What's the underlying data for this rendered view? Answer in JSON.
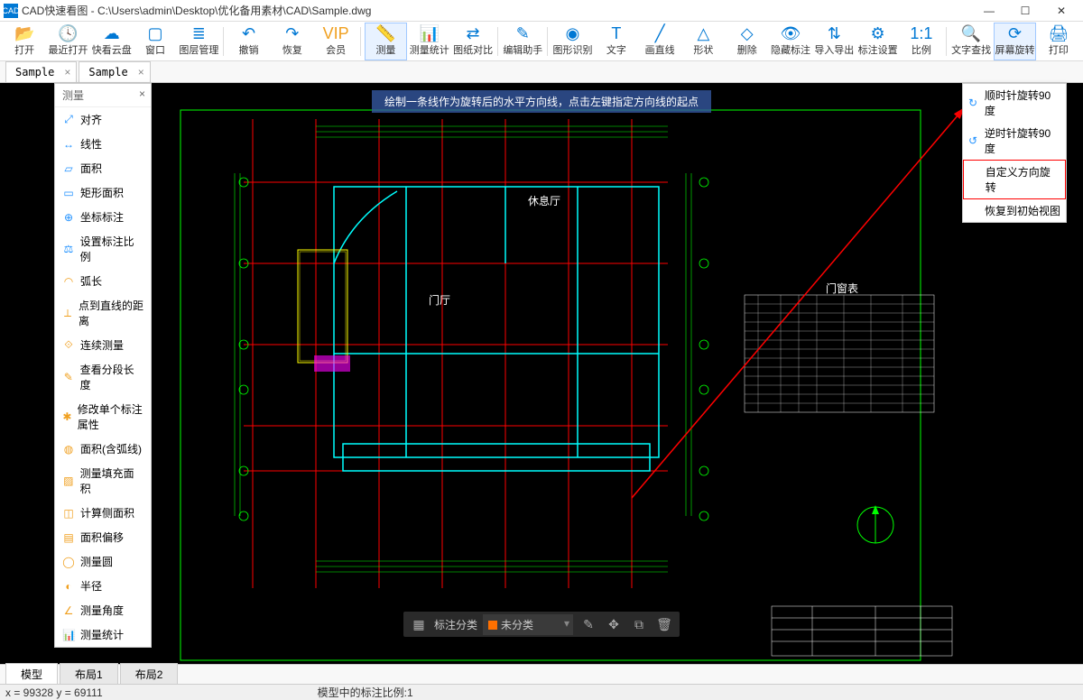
{
  "titlebar": {
    "app": "CAD",
    "text": "CAD快速看图 - C:\\Users\\admin\\Desktop\\优化备用素材\\CAD\\Sample.dwg"
  },
  "toolbar": [
    {
      "icon": "📂",
      "label": "打开"
    },
    {
      "icon": "🕓",
      "label": "最近打开"
    },
    {
      "icon": "☁",
      "label": "快看云盘"
    },
    {
      "icon": "▢",
      "label": "窗口"
    },
    {
      "icon": "≣",
      "label": "图层管理"
    },
    {
      "div": true
    },
    {
      "icon": "↶",
      "label": "撤销"
    },
    {
      "icon": "↷",
      "label": "恢复"
    },
    {
      "icon": "VIP",
      "label": "会员",
      "vip": true
    },
    {
      "div": true
    },
    {
      "icon": "📏",
      "label": "测量",
      "active": true
    },
    {
      "icon": "📊",
      "label": "测量统计"
    },
    {
      "icon": "⇄",
      "label": "图纸对比"
    },
    {
      "div": true
    },
    {
      "icon": "✎",
      "label": "编辑助手"
    },
    {
      "div": true
    },
    {
      "icon": "◉",
      "label": "图形识别"
    },
    {
      "icon": "T",
      "label": "文字"
    },
    {
      "icon": "╱",
      "label": "画直线"
    },
    {
      "icon": "△",
      "label": "形状"
    },
    {
      "icon": "◇",
      "label": "删除"
    },
    {
      "icon": "👁",
      "label": "隐藏标注"
    },
    {
      "icon": "⇅",
      "label": "导入导出"
    },
    {
      "icon": "⚙",
      "label": "标注设置"
    },
    {
      "icon": "1:1",
      "label": "比例"
    },
    {
      "div": true
    },
    {
      "icon": "🔍",
      "label": "文字查找"
    },
    {
      "icon": "⟳",
      "label": "屏幕旋转",
      "active": true
    },
    {
      "icon": "🖨",
      "label": "打印"
    }
  ],
  "doc_tabs": [
    "Sample",
    "Sample"
  ],
  "side": {
    "title": "测量",
    "items": [
      {
        "ic": "⤢",
        "t": "对齐",
        "c": "blue"
      },
      {
        "ic": "↔",
        "t": "线性",
        "c": "blue"
      },
      {
        "ic": "▱",
        "t": "面积",
        "c": "blue"
      },
      {
        "ic": "▭",
        "t": "矩形面积",
        "c": "blue"
      },
      {
        "ic": "⊕",
        "t": "坐标标注",
        "c": "blue"
      },
      {
        "ic": "⚖",
        "t": "设置标注比例",
        "c": "blue"
      },
      {
        "ic": "◠",
        "t": "弧长"
      },
      {
        "ic": "⟂",
        "t": "点到直线的距离"
      },
      {
        "ic": "⟐",
        "t": "连续测量"
      },
      {
        "ic": "✎",
        "t": "查看分段长度"
      },
      {
        "ic": "✱",
        "t": "修改单个标注属性"
      },
      {
        "ic": "◍",
        "t": "面积(含弧线)"
      },
      {
        "ic": "▨",
        "t": "测量填充面积"
      },
      {
        "ic": "◫",
        "t": "计算侧面积"
      },
      {
        "ic": "▤",
        "t": "面积偏移"
      },
      {
        "ic": "◯",
        "t": "测量圆"
      },
      {
        "ic": "◐",
        "t": "半径"
      },
      {
        "ic": "∠",
        "t": "测量角度"
      },
      {
        "ic": "📊",
        "t": "测量统计"
      }
    ]
  },
  "rotate_menu": [
    {
      "ic": "↻",
      "t": "顺时针旋转90度"
    },
    {
      "ic": "↺",
      "t": "逆时针旋转90度"
    },
    {
      "ic": "",
      "t": "自定义方向旋转",
      "hl": true
    },
    {
      "ic": "",
      "t": "恢复到初始视图"
    }
  ],
  "hint": "绘制一条线作为旋转后的水平方向线，点击左键指定方向线的起点",
  "btm": {
    "label": "标注分类",
    "value": "未分类"
  },
  "layout_tabs": [
    "模型",
    "布局1",
    "布局2"
  ],
  "status": {
    "coords": "x = 99328  y = 69111",
    "scale": "模型中的标注比例:1"
  },
  "drawing": {
    "room1": "休息厅",
    "room2": "门厅",
    "table_title": "门窗表",
    "compass": "➤"
  }
}
